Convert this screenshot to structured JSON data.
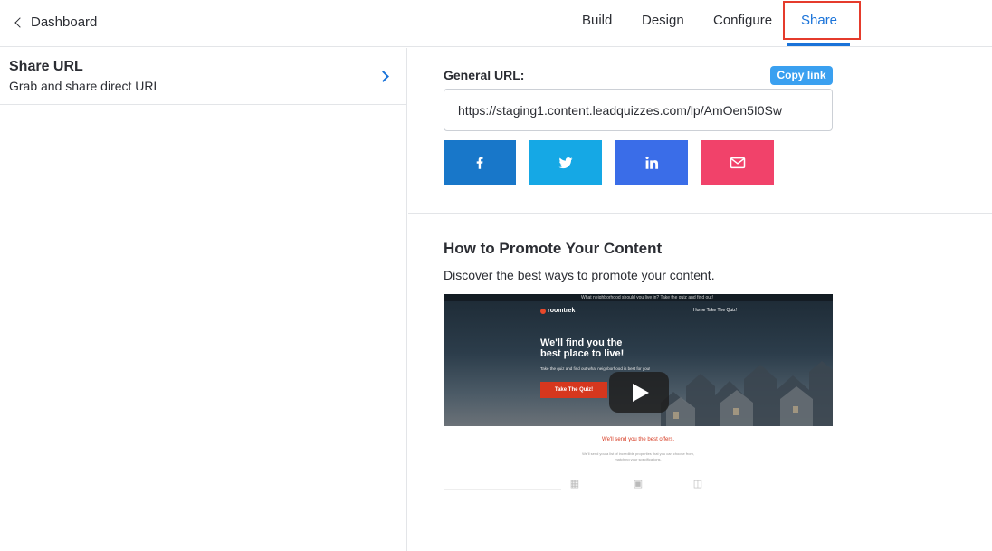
{
  "nav": {
    "back_label": "Dashboard",
    "tabs": [
      {
        "label": "Build"
      },
      {
        "label": "Design"
      },
      {
        "label": "Configure"
      },
      {
        "label": "Share"
      }
    ],
    "active_tab": "Share",
    "accent_color": "#1a73d9",
    "highlight_color": "#e53b2c"
  },
  "sidebar": {
    "items": [
      {
        "title": "Share URL",
        "subtitle": "Grab and share direct URL",
        "icon": "chevron-right-icon"
      }
    ]
  },
  "share": {
    "label": "General URL:",
    "copy_label": "Copy link",
    "url_value": "https://staging1.content.leadquizzes.com/lp/AmOen5I0Sw",
    "buttons": [
      {
        "icon": "facebook-icon",
        "color": "#1877c9"
      },
      {
        "icon": "twitter-icon",
        "color": "#15a8e5"
      },
      {
        "icon": "linkedin-icon",
        "color": "#3a6de8"
      },
      {
        "icon": "email-icon",
        "color": "#f1426a"
      }
    ]
  },
  "promote": {
    "title": "How to Promote Your Content",
    "description": "Discover the best ways to promote your content.",
    "video": {
      "topbar_text": "What neighborhood should you live in? Take the quiz and find out!",
      "brand": "roomtrek",
      "nav_links": "Home    Take The Quiz!",
      "headline_1": "We'll find you the",
      "headline_2": "best place to live!",
      "subline": "Take the quiz and find out what neighborhood is best for you!",
      "cta": "Take The Quiz!",
      "offer_title": "We'll send you the best offers.",
      "offer_sub_1": "We'll send you a list of incredible properties that you can choose from,",
      "offer_sub_2": "matching your specifications."
    }
  }
}
